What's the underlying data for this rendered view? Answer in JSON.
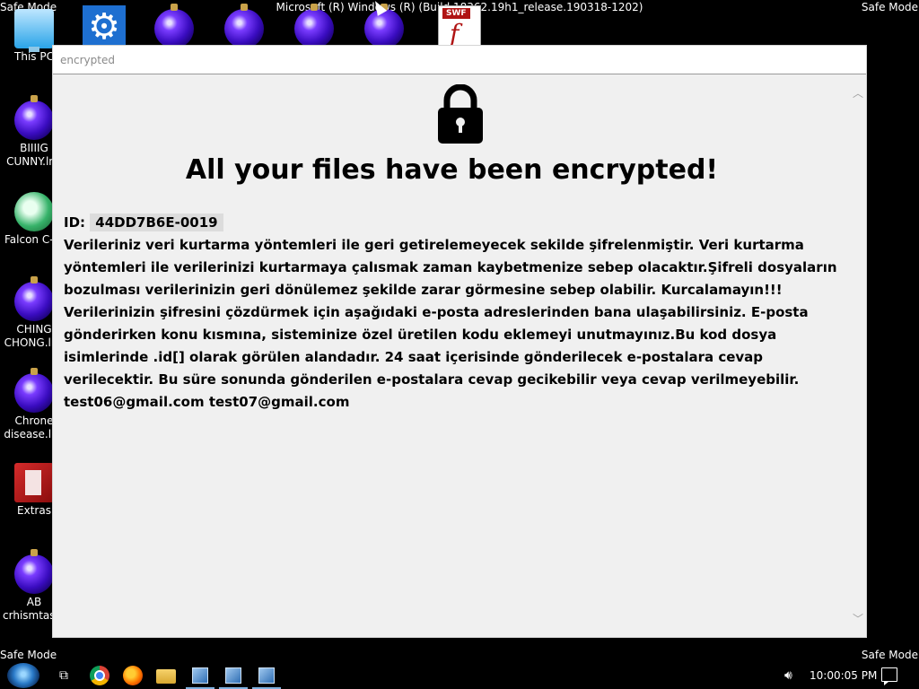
{
  "overlay": {
    "safe_mode_label": "Safe Mode",
    "system_build": "Microsoft (R) Windows (R) (Build 18362.19h1_release.190318-1202)"
  },
  "desktop_icons": [
    {
      "label": "This PC",
      "icon": "computer-icon"
    },
    {
      "label": "BIIIIG CUNNY.lnk",
      "icon": "ornament-icon"
    },
    {
      "label": "Falcon C-...",
      "icon": "recycle-icon"
    },
    {
      "label": "CHING CHONG.lnk",
      "icon": "ornament-icon"
    },
    {
      "label": "Chrone disease.lnk",
      "icon": "ornament-icon"
    },
    {
      "label": "Extras",
      "icon": "folder-icon"
    },
    {
      "label": "AB crhismtas...",
      "icon": "ornament-icon"
    }
  ],
  "window": {
    "title": "encrypted",
    "headline": "All your files have been encrypted!",
    "id_label": "ID:",
    "id_value": "44DD7B6E-0019",
    "paragraph_1": "Verileriniz veri kurtarma yöntemleri ile geri getirelemeyecek sekilde şifrelenmiştir. Veri kurtarma yöntemleri ile verilerinizi kurtarmaya çalısmak zaman kaybetmenize sebep olacaktır.Şifreli dosyaların bozulması verilerinizin geri dönülemez şekilde zarar görmesine sebep olabilir. Kurcalamayın!!!",
    "paragraph_2": "Verilerinizin şifresini çözdürmek için aşağıdaki e-posta adreslerinden bana ulaşabilirsiniz. E-posta gönderirken konu kısmına, sisteminize özel üretilen kodu eklemeyi unutmayınız.Bu kod dosya isimlerinde .id[] olarak görülen alandadır. 24 saat içerisinde gönderilecek e-postalara cevap verilecektir. Bu süre sonunda gönderilen e-postalara cevap gecikebilir veya cevap verilmeyebilir.",
    "contact_emails": "test06@gmail.com test07@gmail.com"
  },
  "taskbar": {
    "clock": "10:00:05 PM",
    "items": [
      "start-icon",
      "task-view-icon",
      "chrome-icon",
      "firefox-icon",
      "file-explorer-icon",
      "app-icon",
      "app-icon",
      "app-icon"
    ]
  }
}
